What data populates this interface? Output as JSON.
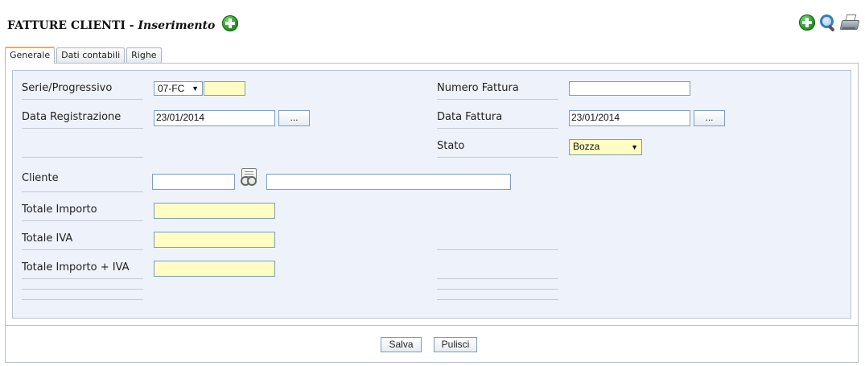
{
  "header": {
    "title": "FATTURE CLIENTI",
    "separator": " - ",
    "mode": "Inserimento",
    "icons": [
      "add-icon",
      "search-icon",
      "print-icon"
    ]
  },
  "tabs": [
    {
      "label": "Generale",
      "active": true
    },
    {
      "label": "Dati contabili",
      "active": false
    },
    {
      "label": "Righe",
      "active": false
    }
  ],
  "form": {
    "serie_label": "Serie/Progressivo",
    "serie_value": "07-FC",
    "progressivo_value": "",
    "numero_fattura_label": "Numero Fattura",
    "numero_fattura_value": "",
    "data_registrazione_label": "Data Registrazione",
    "data_registrazione_value": "23/01/2014",
    "data_fattura_label": "Data Fattura",
    "data_fattura_value": "23/01/2014",
    "date_picker_label": "...",
    "stato_label": "Stato",
    "stato_value": "Bozza",
    "cliente_label": "Cliente",
    "cliente_code": "",
    "cliente_name": "",
    "totale_importo_label": "Totale Importo",
    "totale_importo_value": "",
    "totale_iva_label": "Totale IVA",
    "totale_iva_value": "",
    "totale_importo_iva_label": "Totale Importo + IVA",
    "totale_importo_iva_value": ""
  },
  "footer": {
    "save_label": "Salva",
    "clear_label": "Pulisci"
  },
  "colors": {
    "form_background": "#eef2fa",
    "readonly_field": "#fffdc4",
    "active_tab_accent": "#f0b040",
    "icon_green": "#2e9a2b"
  }
}
